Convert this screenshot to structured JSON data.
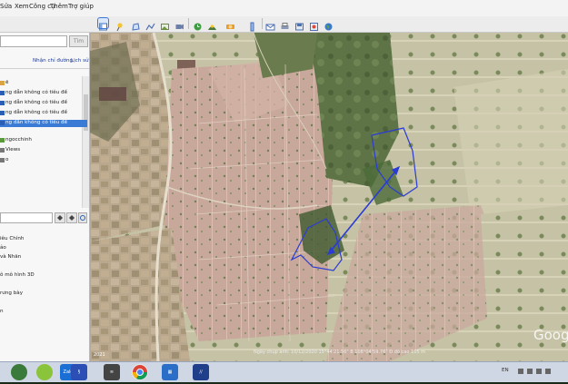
{
  "menu": {
    "items": [
      "Sửa",
      "Xem",
      "Công cụ",
      "Thêm",
      "Trợ giúp"
    ]
  },
  "search": {
    "button": "Tìm"
  },
  "tabs": {
    "directions": "Nhận chỉ đường",
    "history": "Lịch sử"
  },
  "places": {
    "items": [
      {
        "label": "ẽ",
        "highlighted": false
      },
      {
        "label": "ng dẫn không có tiêu đề",
        "highlighted": false
      },
      {
        "label": "ng dẫn không có tiêu đề",
        "highlighted": false
      },
      {
        "label": "ng dẫn không có tiêu đề",
        "highlighted": false
      },
      {
        "label": "ng dẫn không có tiêu đề",
        "highlighted": true
      },
      {
        "label": "ngocchinh",
        "highlighted": false
      },
      {
        "label": "Views",
        "highlighted": false
      },
      {
        "label": "o",
        "highlighted": false
      }
    ]
  },
  "layers": {
    "items": [
      "iêu Chính",
      "ảo",
      "và Nhãn",
      "",
      "ô mô hình 3D",
      "",
      "rưng bày",
      "",
      "n"
    ]
  },
  "map": {
    "watermark": "Google",
    "status": "Ngày chụp ảnh: 10/12/2020    15°44'21.56\" B  108°04'59.76\" Đ   độ cao 105 m",
    "year_tag": "2021"
  },
  "taskbar": {
    "tray_lang": "EN"
  },
  "colors": {
    "route": "#2b3cd4",
    "highlight": "#3a7bd5"
  }
}
